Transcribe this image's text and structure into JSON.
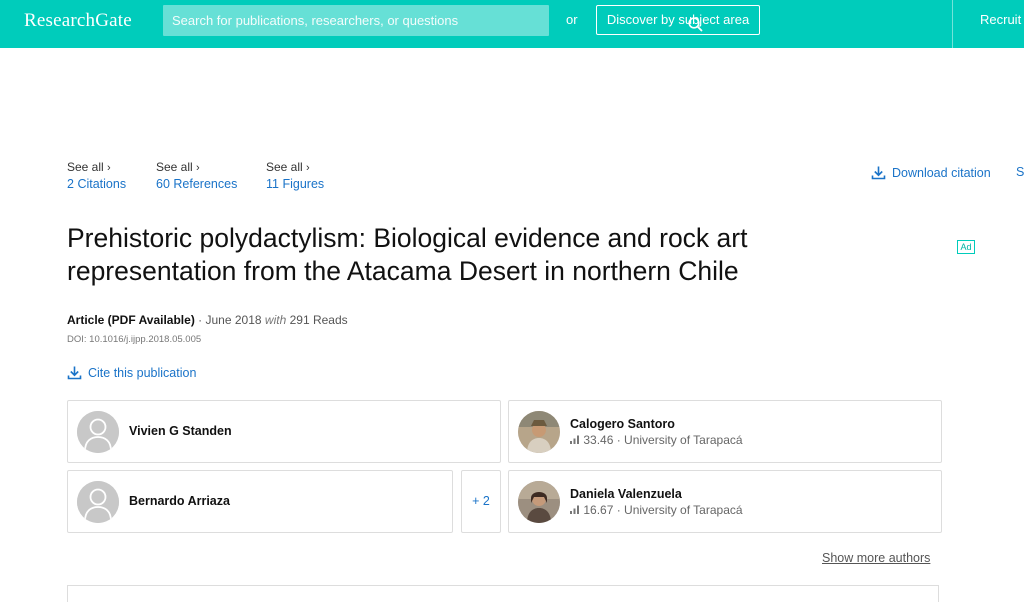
{
  "header": {
    "logo": "ResearchGate",
    "search_placeholder": "Search for publications, researchers, or questions",
    "or_label": "or",
    "discover_label": "Discover by subject area",
    "recruit_label": "Recruit",
    "brand_color": "#00ccbb"
  },
  "stats": [
    {
      "see_all": "See all",
      "count": "2",
      "label": "Citations"
    },
    {
      "see_all": "See all",
      "count": "60",
      "label": "References"
    },
    {
      "see_all": "See all",
      "count": "11",
      "label": "Figures"
    }
  ],
  "actions": {
    "download_citation": "Download citation",
    "next_action_clipped": "S",
    "ad_badge": "Ad",
    "cite": "Cite this publication"
  },
  "publication": {
    "title": "Prehistoric polydactylism: Biological evidence and rock art representation from the Atacama Desert in northern Chile",
    "type": "Article (PDF Available)",
    "separator": "·",
    "date": "June 2018",
    "with": "with",
    "reads": "291 Reads",
    "doi": "DOI: 10.1016/j.ijpp.2018.05.005"
  },
  "authors": [
    {
      "name": "Vivien G Standen",
      "score": "",
      "affiliation": "",
      "avatar": "default"
    },
    {
      "name": "Calogero Santoro",
      "score": "33.46",
      "affiliation": "University of Tarapacá",
      "avatar": "photo"
    },
    {
      "name": "Bernardo Arriaza",
      "score": "",
      "affiliation": "",
      "avatar": "default"
    },
    {
      "name": "Daniela Valenzuela",
      "score": "16.67",
      "affiliation": "University of Tarapacá",
      "avatar": "photo"
    }
  ],
  "more_authors": "+ 2",
  "show_more_authors": "Show more authors"
}
